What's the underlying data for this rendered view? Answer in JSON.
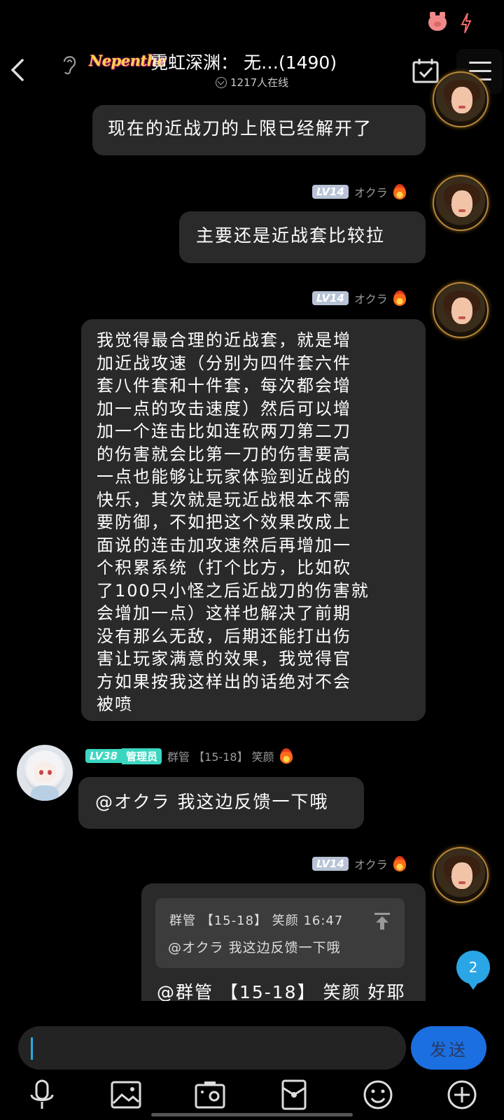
{
  "status_bar": {
    "icons": [
      "pig-icon",
      "bolt-icon"
    ]
  },
  "header": {
    "logo_text": "Nepenthe",
    "title": "霓虹深渊： 无…(1490)",
    "online_text": "1217人在线"
  },
  "messages": [
    {
      "text": "现在的近战刀的上限已经解开了"
    },
    {
      "level": "LV14",
      "name": "オクラ",
      "text": "主要还是近战套比较拉"
    },
    {
      "level": "LV14",
      "name": "オクラ",
      "lines": [
        "我觉得最合理的近战套，就是增",
        "加近战攻速（分别为四件套六件",
        "套八件套和十件套，每次都会增",
        "加一点的攻击速度）然后可以增",
        "加一个连击比如连砍两刀第二刀",
        "的伤害就会比第一刀的伤害要高",
        "一点也能够让玩家体验到近战的",
        "快乐，其次就是玩近战根本不需",
        "要防御，不如把这个效果改成上",
        "面说的连击加攻速然后再增加一",
        "个积累系统（打个比方，比如砍",
        "了100只小怪之后近战刀的伤害就",
        "会增加一点）这样也解决了前期",
        "没有那么无敌，后期还能打出伤",
        "害让玩家满意的效果，我觉得官",
        "方如果按我这样出的话绝对不会",
        "被喷"
      ]
    },
    {
      "level": "LV38",
      "role": "管理员",
      "name": "群管 【15-18】 笑颜",
      "text": "@オクラ 我这边反馈一下哦"
    },
    {
      "level": "LV14",
      "name": "オクラ",
      "quote_head": "群管 【15-18】 笑颜 16:47",
      "quote_body": "@オクラ 我这边反馈一下哦",
      "text": "@群管 【15-18】 笑颜 好耶"
    }
  ],
  "unread_badge": "2",
  "input": {
    "send_label": "发送"
  },
  "toolbar": [
    "microphone-icon",
    "image-icon",
    "camera-icon",
    "red-packet-icon",
    "emoji-icon",
    "plus-icon"
  ]
}
